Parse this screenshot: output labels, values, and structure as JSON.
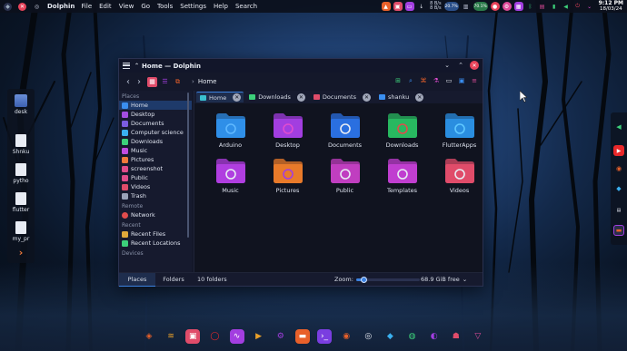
{
  "top_panel": {
    "app_name": "Dolphin",
    "menu": [
      "File",
      "Edit",
      "View",
      "Go",
      "Tools",
      "Settings",
      "Help",
      "Search"
    ],
    "net_up": "8 B/s",
    "net_down": "8 B/s",
    "cpu": "20.7%",
    "mem": "70.1%",
    "time": "9:12 PM",
    "date": "18/03/24"
  },
  "desktop_icons": [
    {
      "label": "desk"
    },
    {
      "label": "Shnku"
    },
    {
      "label": "pytho"
    },
    {
      "label": "flutter"
    },
    {
      "label": "my_pr"
    }
  ],
  "window": {
    "title": "Home — Dolphin",
    "breadcrumb": "Home"
  },
  "sidebar": {
    "sections": [
      {
        "title": "Places",
        "items": [
          {
            "label": "Home",
            "color": "#3a8ef0"
          },
          {
            "label": "Desktop",
            "color": "#a24de0"
          },
          {
            "label": "Documents",
            "color": "#7b5ce0"
          },
          {
            "label": "Computer science",
            "color": "#3ab0f0"
          },
          {
            "label": "Downloads",
            "color": "#3cd07a"
          },
          {
            "label": "Music",
            "color": "#c04ce0"
          },
          {
            "label": "Pictures",
            "color": "#f07a3a"
          },
          {
            "label": "screenshot",
            "color": "#e04c8a"
          },
          {
            "label": "Public",
            "color": "#e04c8a"
          },
          {
            "label": "Videos",
            "color": "#e04c6a"
          },
          {
            "label": "Trash",
            "color": "#9aa3b8"
          }
        ]
      },
      {
        "title": "Remote",
        "items": [
          {
            "label": "Network",
            "color": "#e04c4c"
          }
        ]
      },
      {
        "title": "Recent",
        "items": [
          {
            "label": "Recent Files",
            "color": "#e0a83a"
          },
          {
            "label": "Recent Locations",
            "color": "#3cd07a"
          }
        ]
      },
      {
        "title": "Devices",
        "items": []
      }
    ]
  },
  "tabs": [
    {
      "label": "Home",
      "color": "#3ac0d0"
    },
    {
      "label": "Downloads",
      "color": "#3cd07a"
    },
    {
      "label": "Documents",
      "color": "#e04c6a"
    },
    {
      "label": "shanku",
      "color": "#3a8ef0"
    }
  ],
  "folders": [
    {
      "label": "Arduino",
      "icon": "arduino-folder-icon",
      "color": "#2f8fe8",
      "accent": "#5fb8ff"
    },
    {
      "label": "Desktop",
      "icon": "desktop-folder-icon",
      "color": "#a23ee0",
      "accent": "#e04cd0"
    },
    {
      "label": "Documents",
      "icon": "documents-folder-icon",
      "color": "#2a6fe0",
      "accent": "#e8ecf4"
    },
    {
      "label": "Downloads",
      "icon": "downloads-folder-icon",
      "color": "#28b860",
      "accent": "#e04c4c"
    },
    {
      "label": "FlutterApps",
      "icon": "flutter-folder-icon",
      "color": "#2a8ee0",
      "accent": "#5fc8ff"
    },
    {
      "label": "Music",
      "icon": "music-folder-icon",
      "color": "#b03ee0",
      "accent": "#e8ecf4"
    },
    {
      "label": "Pictures",
      "icon": "pictures-folder-icon",
      "color": "#e87a2a",
      "accent": "#a23ee0"
    },
    {
      "label": "Public",
      "icon": "public-folder-icon",
      "color": "#c03ec0",
      "accent": "#e8ecf4"
    },
    {
      "label": "Templates",
      "icon": "templates-folder-icon",
      "color": "#c03ed0",
      "accent": "#e8ecf4"
    },
    {
      "label": "Videos",
      "icon": "videos-folder-icon",
      "color": "#e04c6a",
      "accent": "#e8ecf4"
    }
  ],
  "statusbar": {
    "places_tab": "Places",
    "folders_tab": "Folders",
    "count": "10 folders",
    "zoom_label": "Zoom:",
    "zoom_level": 0.12,
    "free_space": "68.9 GiB free"
  }
}
